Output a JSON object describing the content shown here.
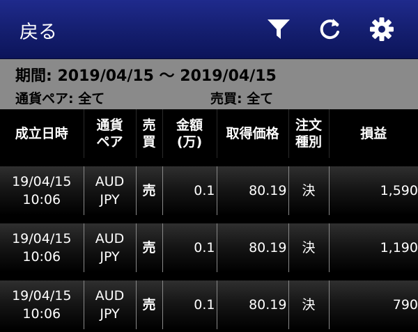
{
  "nav": {
    "back_label": "戻る",
    "icons": [
      "filter-icon",
      "refresh-icon",
      "gear-icon"
    ]
  },
  "conditions": {
    "period": "期間: 2019/04/15 〜 2019/04/15",
    "currency_pair": "通貨ペア: 全て",
    "side": "売買: 全て"
  },
  "table": {
    "headers": [
      {
        "line1": "成立日時",
        "line2": ""
      },
      {
        "line1": "通貨",
        "line2": "ペア"
      },
      {
        "line1": "売",
        "line2": "買"
      },
      {
        "line1": "金額",
        "line2": "(万)"
      },
      {
        "line1": "取得価格",
        "line2": ""
      },
      {
        "line1": "注文",
        "line2": "種別"
      },
      {
        "line1": "損益",
        "line2": ""
      }
    ],
    "rows": [
      {
        "date": "19/04/15",
        "time": "10:06",
        "pair1": "AUD",
        "pair2": "JPY",
        "side": "売",
        "amount": "0.1",
        "price": "80.19",
        "type": "決",
        "pnl": "1,590"
      },
      {
        "date": "19/04/15",
        "time": "10:06",
        "pair1": "AUD",
        "pair2": "JPY",
        "side": "売",
        "amount": "0.1",
        "price": "80.19",
        "type": "決",
        "pnl": "1,190"
      },
      {
        "date": "19/04/15",
        "time": "10:06",
        "pair1": "AUD",
        "pair2": "JPY",
        "side": "売",
        "amount": "0.1",
        "price": "80.19",
        "type": "決",
        "pnl": "790"
      }
    ]
  },
  "colors": {
    "navbar": "#141e6e",
    "condition_bg": "#8a8a8a",
    "side_text": "#39e1f0"
  }
}
